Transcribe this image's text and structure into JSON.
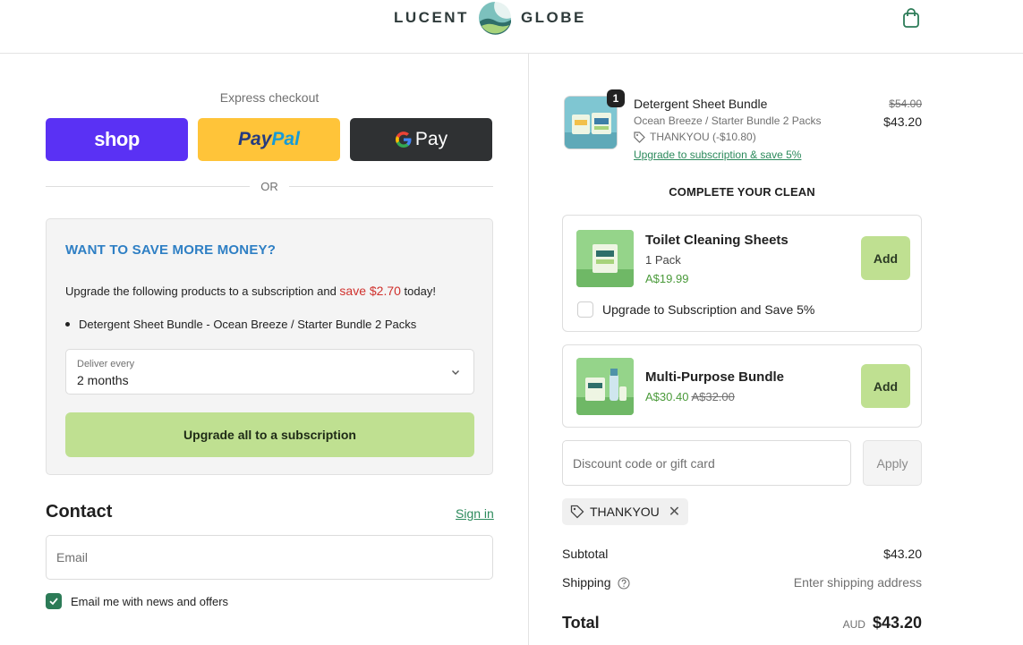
{
  "header": {
    "brand_left": "LUCENT",
    "brand_right": "GLOBE",
    "icons": {
      "logo": "moon-wave-logo",
      "cart": "shopping-bag-icon"
    }
  },
  "express": {
    "label": "Express checkout",
    "buttons": {
      "shop": "shop",
      "paypal_a": "Pay",
      "paypal_b": "Pal",
      "gpay": "Pay"
    },
    "divider": "OR"
  },
  "save_offer": {
    "title": "WANT TO SAVE MORE MONEY?",
    "desc_prefix": "Upgrade the following products to a subscription and ",
    "desc_amount": "save $2.70",
    "desc_suffix": " today!",
    "items": [
      "Detergent Sheet Bundle - Ocean Breeze / Starter Bundle 2 Packs"
    ],
    "deliver_label": "Deliver every",
    "deliver_value": "2 months",
    "cta": "Upgrade all to a subscription"
  },
  "contact": {
    "title": "Contact",
    "sign_in": "Sign in",
    "email_placeholder": "Email",
    "newsletter_label": "Email me with news and offers",
    "newsletter_checked": true
  },
  "cart": {
    "item": {
      "qty": "1",
      "name": "Detergent Sheet Bundle",
      "variant": "Ocean Breeze / Starter Bundle 2 Packs",
      "discount": "THANKYOU (-$10.80)",
      "upgrade_link": "Upgrade to subscription & save 5%",
      "compare_price": "$54.00",
      "price": "$43.20"
    }
  },
  "upsell": {
    "title": "COMPLETE YOUR CLEAN",
    "products": [
      {
        "name": "Toilet Cleaning Sheets",
        "sub": "1 Pack",
        "price": "A$19.99",
        "add_label": "Add",
        "subscribe_label": "Upgrade to Subscription and Save 5%"
      },
      {
        "name": "Multi-Purpose Bundle",
        "price": "A$30.40",
        "compare_price": "A$32.00",
        "add_label": "Add"
      }
    ]
  },
  "discount": {
    "placeholder": "Discount code or gift card",
    "apply_label": "Apply",
    "applied_code": "THANKYOU"
  },
  "summary": {
    "subtotal_label": "Subtotal",
    "subtotal_value": "$43.20",
    "shipping_label": "Shipping",
    "shipping_value": "Enter shipping address",
    "total_label": "Total",
    "currency": "AUD",
    "total_value": "$43.20"
  },
  "colors": {
    "accent_green": "#2c8a5c",
    "button_green": "#bfe091",
    "save_title_blue": "#2e7fc4",
    "save_amount_red": "#d0312d",
    "shop_purple": "#5a31f4",
    "paypal_yellow": "#ffc439"
  }
}
